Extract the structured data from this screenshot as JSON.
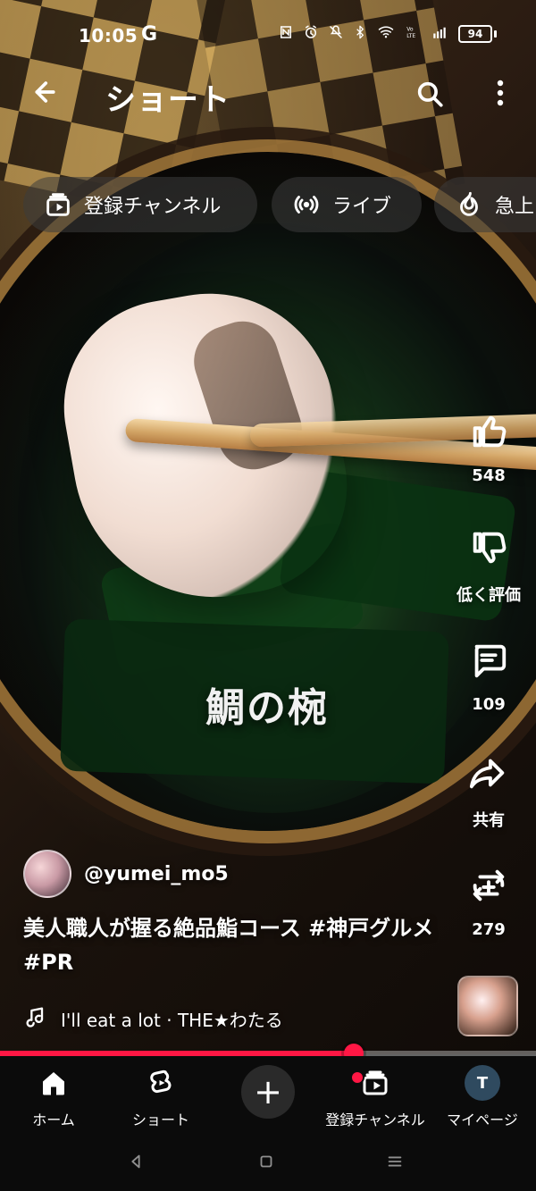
{
  "status_bar": {
    "time": "10:05",
    "g_label": "G",
    "battery": "94",
    "icons": [
      "nfc-icon",
      "alarm-icon",
      "mute-icon",
      "bluetooth-icon",
      "wifi-icon",
      "volte-icon",
      "signal-icon"
    ]
  },
  "header": {
    "title": "ショート",
    "back_icon": "arrow-left-icon",
    "search_icon": "search-icon",
    "more_icon": "more-vert-icon"
  },
  "chips": [
    {
      "label": "登録チャンネル",
      "icon": "subscriptions-icon"
    },
    {
      "label": "ライブ",
      "icon": "live-icon"
    },
    {
      "label": "急上",
      "icon": "trending-icon"
    }
  ],
  "video": {
    "overlay_text": "鯛の椀"
  },
  "actions": [
    {
      "id": "like",
      "icon": "thumb-up-icon",
      "label": "548"
    },
    {
      "id": "dislike",
      "icon": "thumb-down-icon",
      "label": "低く評価"
    },
    {
      "id": "comments",
      "icon": "comment-icon",
      "label": "109"
    },
    {
      "id": "share",
      "icon": "share-icon",
      "label": "共有"
    },
    {
      "id": "remix",
      "icon": "remix-icon",
      "label": "279"
    }
  ],
  "meta": {
    "channel_handle": "@yumei_mo5",
    "caption": "美人職人が握る絶品鮨コース #神戸グルメ #PR",
    "music": "I'll eat a lot · THE★わたる",
    "music_icon": "music-note-icon"
  },
  "progress": {
    "value": 0.66,
    "accent": "#FF1744",
    "track": "#FFFFFF59"
  },
  "bottom_nav": {
    "home": "ホーム",
    "shorts": "ショート",
    "create_icon": "plus-icon",
    "subscriptions": "登録チャンネル",
    "my_page": "マイページ",
    "avatar_letter": "T",
    "has_notification_dot": true
  },
  "system_nav": {
    "back_icon": "nav-back-icon",
    "home_icon": "nav-home-icon",
    "recents_icon": "nav-recents-icon"
  }
}
